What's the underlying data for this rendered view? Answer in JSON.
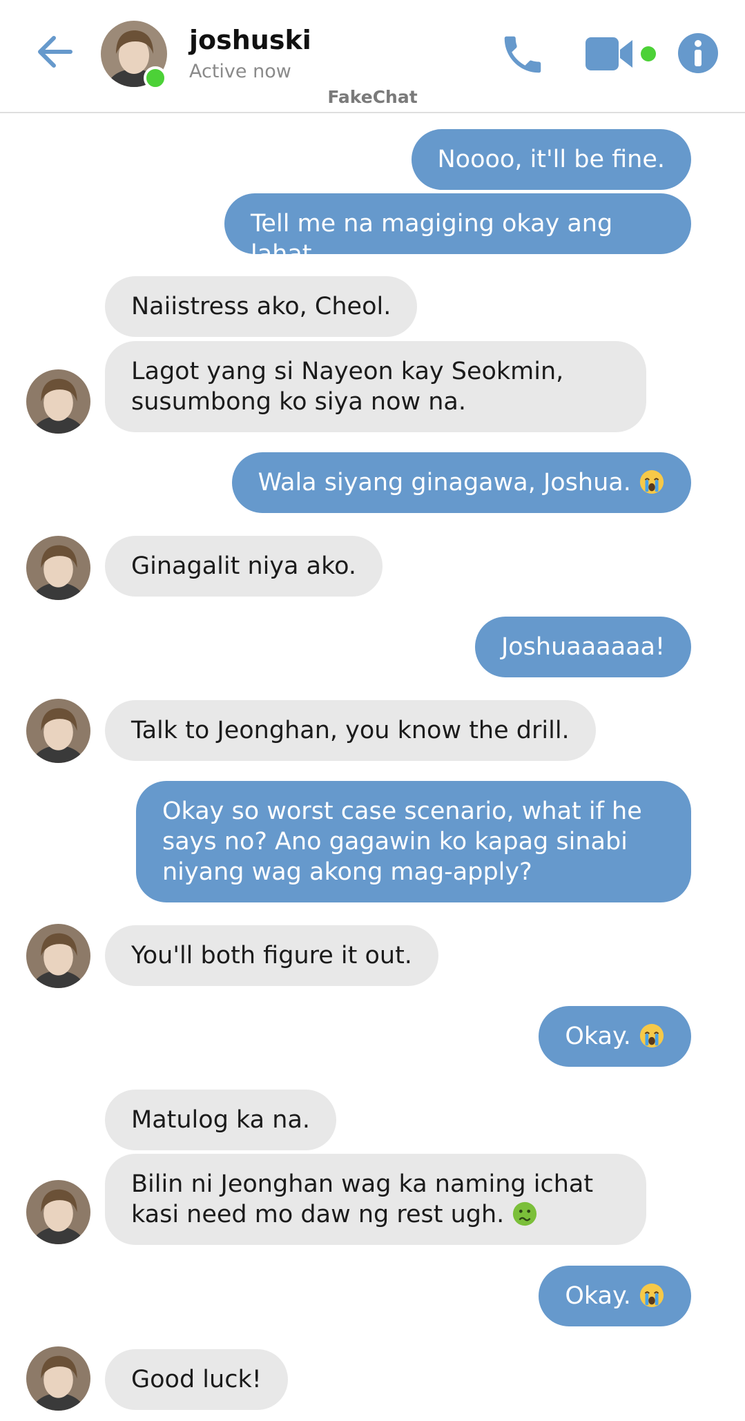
{
  "header": {
    "contact_name": "joshuski",
    "status": "Active now",
    "app_brand": "FakeChat"
  },
  "colors": {
    "accent": "#6699cc",
    "incoming_bubble": "#e8e8e8",
    "online": "#4cd137"
  },
  "icons": [
    "back-arrow-icon",
    "phone-icon",
    "video-camera-icon",
    "info-icon",
    "crying-emoji-icon",
    "nauseated-emoji-icon"
  ],
  "messages": [
    {
      "dir": "out",
      "text": "Noooo, it'll be fine."
    },
    {
      "dir": "out",
      "text": "Tell me na magiging okay ang lahat."
    },
    {
      "dir": "in",
      "text": "Naiistress ako, Cheol."
    },
    {
      "dir": "in",
      "text": "Lagot yang si Nayeon kay Seokmin,\nsusumbong ko siya now na."
    },
    {
      "dir": "out",
      "text": "Wala siyang ginagawa, Joshua.",
      "emoji": "crying"
    },
    {
      "dir": "in",
      "text": "Ginagalit niya ako."
    },
    {
      "dir": "out",
      "text": "Joshuaaaaaa!"
    },
    {
      "dir": "in",
      "text": "Talk to Jeonghan, you know the drill."
    },
    {
      "dir": "out",
      "text": "Okay so worst case scenario, what if he\nsays no? Ano gagawin ko kapag sinabi\nniyang wag akong mag-apply?"
    },
    {
      "dir": "in",
      "text": "You'll both figure it out."
    },
    {
      "dir": "out",
      "text": "Okay.",
      "emoji": "crying"
    },
    {
      "dir": "in",
      "text": "Matulog ka na."
    },
    {
      "dir": "in",
      "text": "Bilin ni Jeonghan wag ka naming ichat\nkasi need mo daw ng rest ugh.",
      "emoji": "nauseated"
    },
    {
      "dir": "out",
      "text": "Okay.",
      "emoji": "crying"
    },
    {
      "dir": "in",
      "text": "Good luck!"
    }
  ]
}
